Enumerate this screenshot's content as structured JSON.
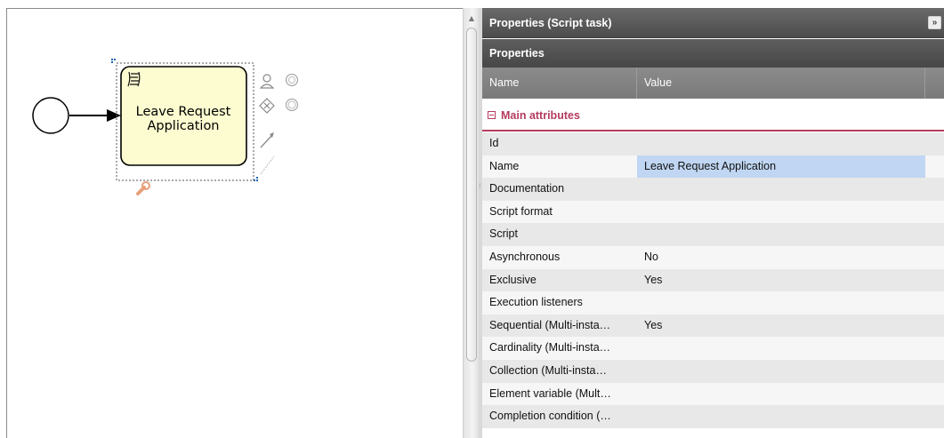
{
  "canvas": {
    "task": {
      "label_line1": "Leave Request",
      "label_line2": "Application"
    }
  },
  "panel": {
    "title": "Properties (Script task)",
    "collapse_glyph": "»",
    "section_title": "Properties",
    "columns": {
      "name": "Name",
      "value": "Value"
    },
    "group": {
      "title": "Main attributes"
    },
    "rows": [
      {
        "name": "Id",
        "value": ""
      },
      {
        "name": "Name",
        "value": "Leave Request Application"
      },
      {
        "name": "Documentation",
        "value": ""
      },
      {
        "name": "Script format",
        "value": ""
      },
      {
        "name": "Script",
        "value": ""
      },
      {
        "name": "Asynchronous",
        "value": "No"
      },
      {
        "name": "Exclusive",
        "value": "Yes"
      },
      {
        "name": "Execution listeners",
        "value": ""
      },
      {
        "name": "Sequential (Multi-insta…",
        "value": "Yes"
      },
      {
        "name": "Cardinality (Multi-insta…",
        "value": ""
      },
      {
        "name": "Collection (Multi-insta…",
        "value": ""
      },
      {
        "name": "Element variable (Mult…",
        "value": ""
      },
      {
        "name": "Completion condition (…",
        "value": ""
      }
    ]
  },
  "icons": {
    "script": "script-icon",
    "user": "user-icon",
    "gateway": "gateway-icon",
    "end_event": "end-event-icon",
    "intermediate": "intermediate-event-icon",
    "arrow": "sequence-flow-icon",
    "association": "association-icon",
    "wrench": "wrench-icon"
  },
  "colors": {
    "task_fill": "#fdfbd0",
    "selection": "#1f66b6",
    "group_accent": "#b53c5e",
    "selected_value": "#c0d6f2",
    "header_dark": "#4c4c4c"
  }
}
